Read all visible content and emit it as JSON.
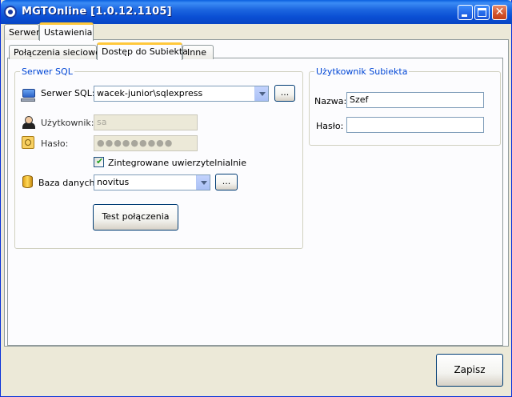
{
  "window": {
    "title": "MGTOnline [1.0.12.1105]"
  },
  "main_tabs": [
    "Serwer",
    "Ustawienia"
  ],
  "sub_tabs": [
    "Połączenia sieciowe",
    "Dostęp do Subiekta",
    "Inne"
  ],
  "sql_group": {
    "title": "Serwer SQL",
    "server_label": "Serwer SQL:",
    "server_value": "wacek-junior\\sqlexpress",
    "browse_button": "...",
    "user_label": "Użytkownik:",
    "user_value": "sa",
    "password_label": "Hasło:",
    "password_value": "●●●●●●●●●",
    "integrated_auth_label": "Zintegrowane uwierzytelnialnie",
    "integrated_auth_checked": true,
    "database_label": "Baza danych:",
    "database_value": "novitus",
    "db_browse_button": "...",
    "test_button": "Test połączenia"
  },
  "subiekt_user_group": {
    "title": "Użytkownik Subiekta",
    "name_label": "Nazwa:",
    "name_value": "Szef",
    "password_label": "Hasło:",
    "password_value": ""
  },
  "footer": {
    "save_button": "Zapisz"
  },
  "colors": {
    "titlebar": "#0a4fd4",
    "group_title": "#0046d5",
    "active_tab_accent": "#ffc83c"
  }
}
